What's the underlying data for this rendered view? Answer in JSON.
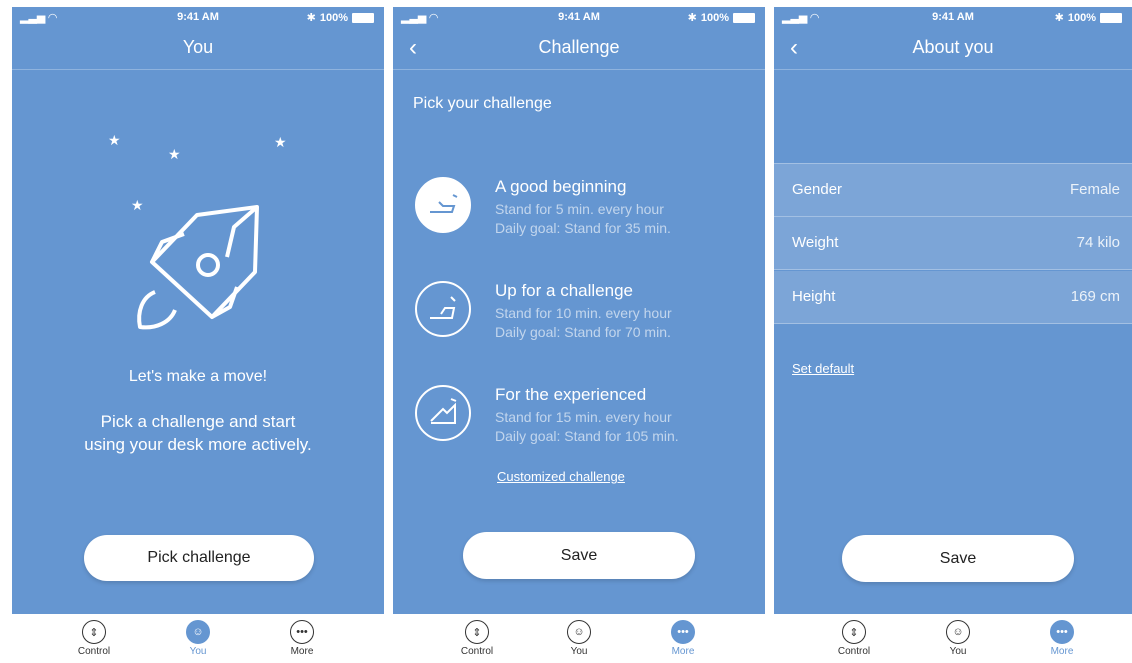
{
  "status": {
    "time": "9:41 AM",
    "battery": "100%"
  },
  "tabs": {
    "control": "Control",
    "you": "You",
    "more": "More"
  },
  "screen1": {
    "title": "You",
    "headline": "Let's make a move!",
    "body_line1": "Pick a challenge and start",
    "body_line2": "using your desk more actively.",
    "button": "Pick challenge"
  },
  "screen2": {
    "title": "Challenge",
    "heading": "Pick your challenge",
    "items": [
      {
        "title": "A good beginning",
        "line1": "Stand for 5 min. every hour",
        "line2": "Daily goal: Stand for 35 min."
      },
      {
        "title": "Up for a challenge",
        "line1": "Stand for 10 min. every hour",
        "line2": "Daily goal: Stand for 70 min."
      },
      {
        "title": "For the experienced",
        "line1": "Stand for 15 min. every hour",
        "line2": "Daily goal: Stand for 105 min."
      }
    ],
    "custom_link": "Customized challenge",
    "button": "Save"
  },
  "screen3": {
    "title": "About you",
    "rows": [
      {
        "label": "Gender",
        "value": "Female"
      },
      {
        "label": "Weight",
        "value": "74 kilo"
      },
      {
        "label": "Height",
        "value": "169 cm"
      }
    ],
    "default_link": "Set default",
    "button": "Save"
  }
}
